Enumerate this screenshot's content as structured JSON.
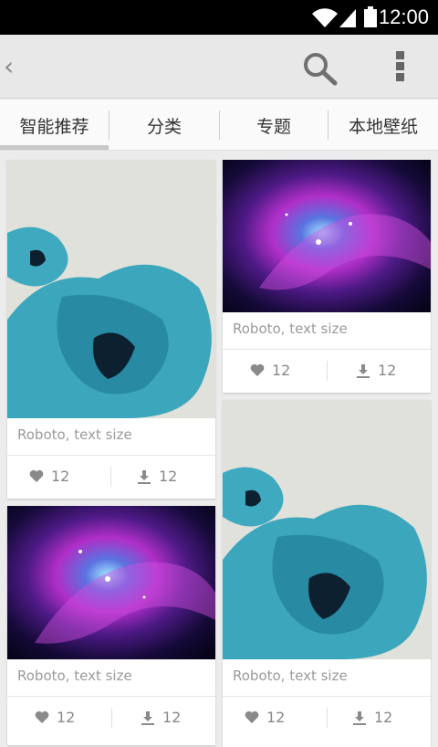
{
  "status_bar": {
    "time": "12:00"
  },
  "action_bar": {
    "back_icon": "chevron-left-icon",
    "search_icon": "search-icon",
    "overflow_icon": "overflow-menu-icon"
  },
  "tabs": [
    {
      "label": "智能推荐",
      "selected": true
    },
    {
      "label": "分类",
      "selected": false
    },
    {
      "label": "专题",
      "selected": false
    },
    {
      "label": "本地壁纸",
      "selected": false
    }
  ],
  "cards": [
    {
      "image": "flower",
      "caption": "Roboto, text size",
      "likes": "12",
      "downloads": "12"
    },
    {
      "image": "nebula",
      "caption": "Roboto, text size",
      "likes": "12",
      "downloads": "12"
    },
    {
      "image": "nebula",
      "caption": "Roboto, text size",
      "likes": "12",
      "downloads": "12"
    },
    {
      "image": "flower",
      "caption": "Roboto, text size",
      "likes": "12",
      "downloads": "12"
    }
  ],
  "colors": {
    "accent_teal": "#22a6bd",
    "nebula_purple": "#8a2bb2"
  }
}
